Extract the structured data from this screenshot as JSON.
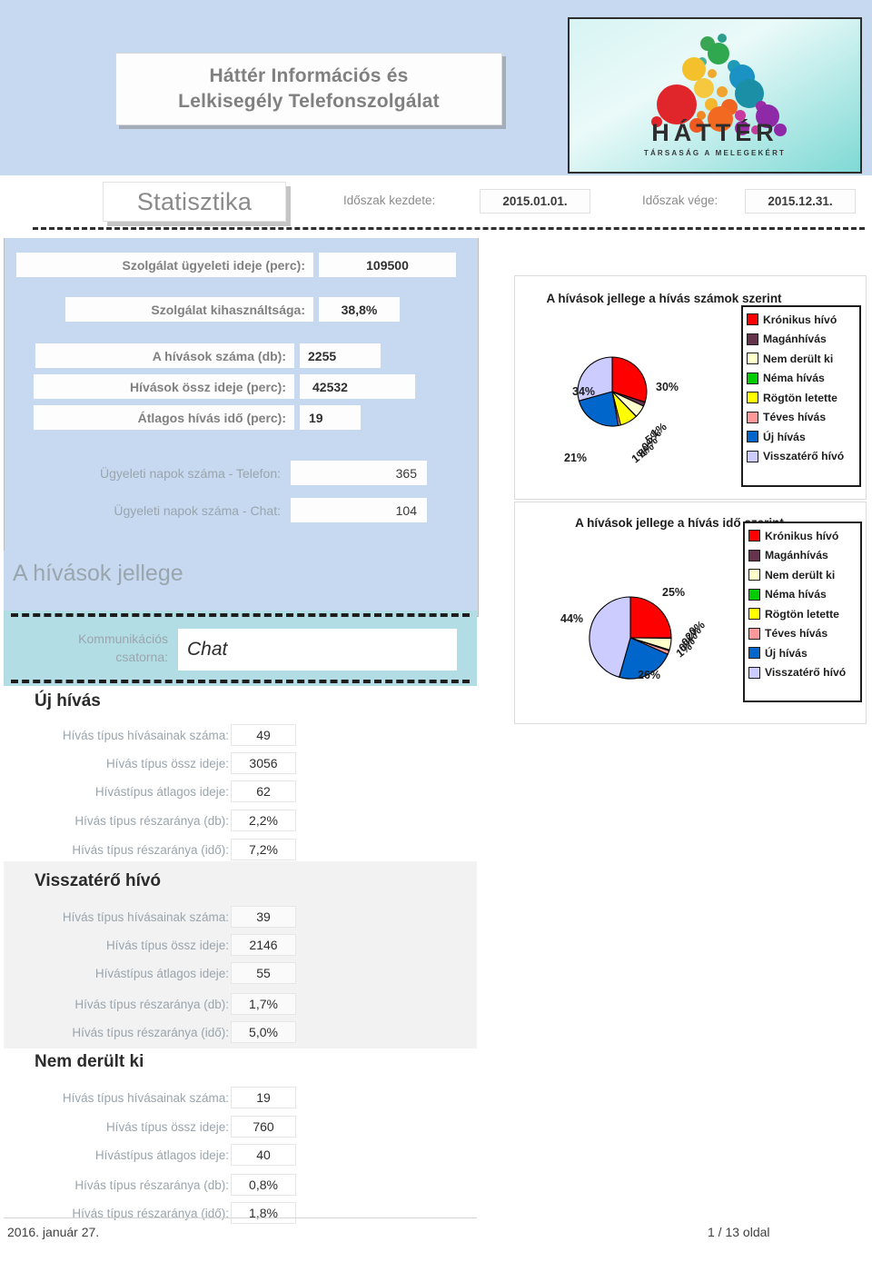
{
  "header": {
    "title_line1": "Háttér Információs és",
    "title_line2": "Lelkisegély Telefonszolgálat",
    "logo_word": "HÁTTÉR",
    "logo_sub": "TÁRSASÁG A MELEGEKÉRT"
  },
  "toolbar": {
    "stat_label": "Statisztika",
    "period_start_label": "Időszak kezdete:",
    "period_start_value": "2015.01.01.",
    "period_end_label": "Időszak vége:",
    "period_end_value": "2015.12.31."
  },
  "summary": {
    "rows": [
      {
        "label": "Szolgálat ügyeleti ideje (perc):",
        "value": "109500"
      },
      {
        "label": "Szolgálat kihasználtsága:",
        "value": "38,8%"
      },
      {
        "label": "A hívások száma (db):",
        "value": "2255"
      },
      {
        "label": "Hívások össz ideje (perc):",
        "value": "42532"
      },
      {
        "label": "Átlagos hívás idő (perc):",
        "value": "19"
      },
      {
        "label": "Ügyeleti napok száma - Telefon:",
        "value": "365"
      },
      {
        "label": "Ügyeleti napok száma - Chat:",
        "value": "104"
      }
    ]
  },
  "jellege": {
    "heading": "A hívások jellege",
    "channel_label_line1": "Kommunikációs",
    "channel_label_line2": "csatorna:",
    "channel_value": "Chat"
  },
  "call_types": [
    {
      "name": "Új hívás",
      "metrics": [
        {
          "label": "Hívás típus hívásainak száma:",
          "value": "49"
        },
        {
          "label": "Hívás típus össz ideje:",
          "value": "3056"
        },
        {
          "label": "Hívástípus átlagos ideje:",
          "value": "62"
        },
        {
          "label": "Hívás típus részaránya (db):",
          "value": "2,2%"
        },
        {
          "label": "Hívás típus részaránya (idő):",
          "value": "7,2%"
        }
      ]
    },
    {
      "name": "Visszatérő hívó",
      "metrics": [
        {
          "label": "Hívás típus hívásainak száma:",
          "value": "39"
        },
        {
          "label": "Hívás típus össz ideje:",
          "value": "2146"
        },
        {
          "label": "Hívástípus átlagos ideje:",
          "value": "55"
        },
        {
          "label": "Hívás típus részaránya (db):",
          "value": "1,7%"
        },
        {
          "label": "Hívás típus részaránya (idő):",
          "value": "5,0%"
        }
      ]
    },
    {
      "name": "Nem derült ki",
      "metrics": [
        {
          "label": "Hívás típus hívásainak száma:",
          "value": "19"
        },
        {
          "label": "Hívás típus össz ideje:",
          "value": "760"
        },
        {
          "label": "Hívástípus átlagos ideje:",
          "value": "40"
        },
        {
          "label": "Hívás típus részaránya (db):",
          "value": "0,8%"
        },
        {
          "label": "Hívás típus részaránya (idő):",
          "value": "1,8%"
        }
      ]
    }
  ],
  "footer": {
    "date": "2016. január 27.",
    "page": "1 / 13 oldal"
  },
  "chart_data": [
    {
      "type": "pie",
      "title": "A hívások jellege a hívás számok szerint",
      "categories": [
        "Krónikus hívó",
        "Magánhívás",
        "Nem derült ki",
        "Néma hívás",
        "Rögtön letette",
        "Téves hívás",
        "Új hívás",
        "Visszatérő hívó"
      ],
      "values": [
        30,
        1,
        5,
        0,
        8,
        1,
        21,
        34
      ],
      "labels": [
        "30%",
        "1%",
        "5%",
        "0%",
        "8%",
        "1%",
        "21%",
        "34%"
      ],
      "colors": [
        "#FF0000",
        "#66334D",
        "#FFFFCC",
        "#00CC00",
        "#FFFF00",
        "#FF9999",
        "#0066CC",
        "#CCCCFF"
      ],
      "legend_position": "right",
      "grid": false
    },
    {
      "type": "pie",
      "title": "A hívások jellege a hívás idő szerint",
      "categories": [
        "Krónikus hívó",
        "Magánhívás",
        "Nem derült ki",
        "Néma hívás",
        "Rögtön letette",
        "Téves hívás",
        "Új hívás",
        "Visszatérő hívó"
      ],
      "values": [
        25,
        0,
        2,
        0,
        2,
        1,
        26,
        44
      ],
      "labels": [
        "25%",
        "0%",
        "2%",
        "0%",
        "0%",
        "1%",
        "26%",
        "44%"
      ],
      "colors": [
        "#FF0000",
        "#66334D",
        "#FFFFCC",
        "#00CC00",
        "#FFFF00",
        "#FF9999",
        "#0066CC",
        "#CCCCFF"
      ],
      "legend_position": "right",
      "grid": false
    }
  ]
}
